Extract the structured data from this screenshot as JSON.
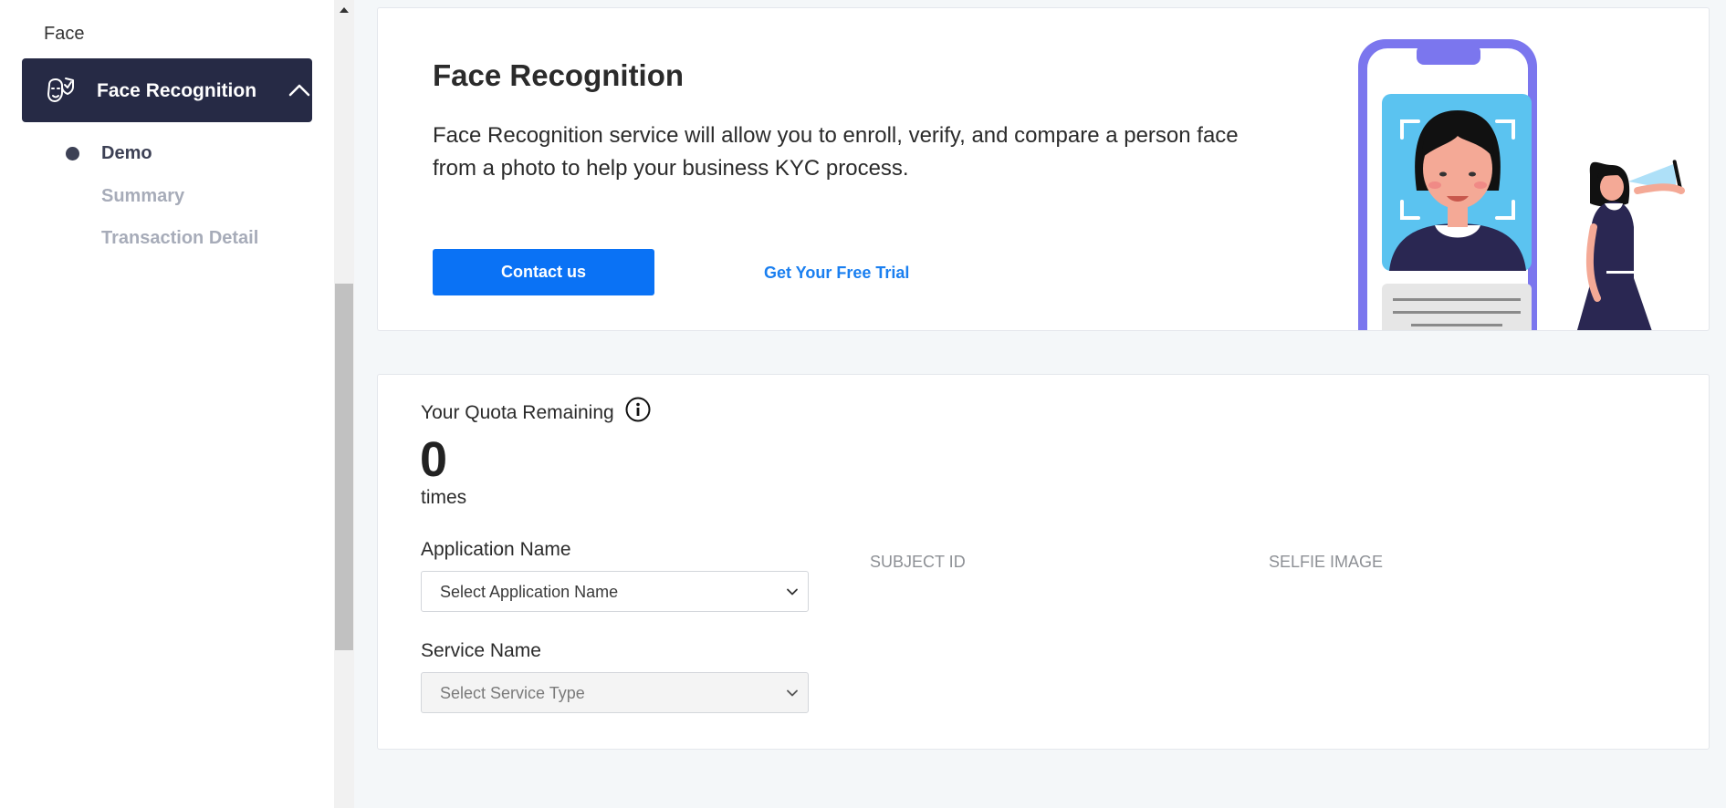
{
  "sidebar": {
    "section_label": "Face",
    "active_menu": {
      "label": "Face Recognition",
      "icon": "face-recognition-icon",
      "expanded_icon": "chevron-up-icon"
    },
    "subitems": [
      {
        "label": "Demo",
        "active": true
      },
      {
        "label": "Summary",
        "active": false
      },
      {
        "label": "Transaction Detail",
        "active": false
      }
    ]
  },
  "hero": {
    "title": "Face Recognition",
    "description": "Face Recognition service will allow you to enroll, verify, and compare a person face from a photo to help your business KYC process.",
    "contact_label": "Contact us",
    "trial_label": "Get Your Free Trial"
  },
  "quota": {
    "label": "Your Quota Remaining",
    "info_icon": "info-icon",
    "value": "0",
    "unit": "times",
    "application": {
      "label": "Application Name",
      "placeholder": "Select Application Name"
    },
    "service": {
      "label": "Service Name",
      "placeholder": "Select Service Type"
    },
    "columns": [
      "SUBJECT ID",
      "SELFIE IMAGE"
    ]
  },
  "colors": {
    "sidebar_active_bg": "#262a45",
    "primary_button": "#0a72f5",
    "link": "#1a7ff0",
    "phone_frame": "#7b76ee",
    "photo_bg": "#5bc3f0"
  }
}
